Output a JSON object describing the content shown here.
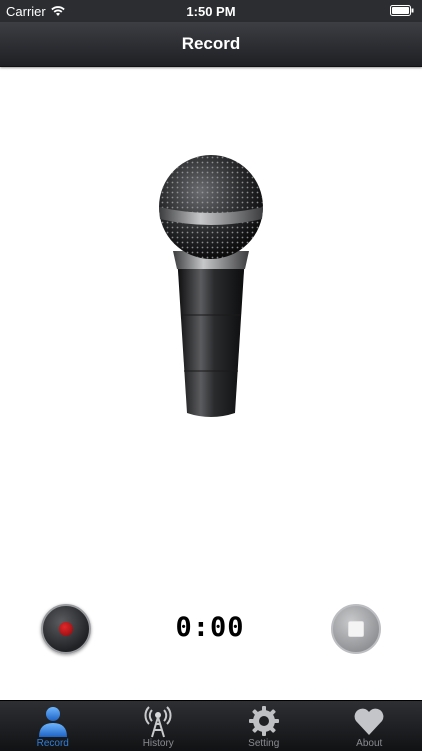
{
  "status_bar": {
    "carrier": "Carrier",
    "time": "1:50 PM"
  },
  "nav": {
    "title": "Record"
  },
  "recorder": {
    "timer": "0:00"
  },
  "tabs": [
    {
      "label": "Record",
      "icon": "person-icon",
      "active": true
    },
    {
      "label": "History",
      "icon": "antenna-icon",
      "active": false
    },
    {
      "label": "Setting",
      "icon": "gear-icon",
      "active": false
    },
    {
      "label": "About",
      "icon": "heart-icon",
      "active": false
    }
  ],
  "colors": {
    "active_tab": "#2f7fdc",
    "record_dot": "#c81e21",
    "nav_bg": "#2b2d31"
  }
}
